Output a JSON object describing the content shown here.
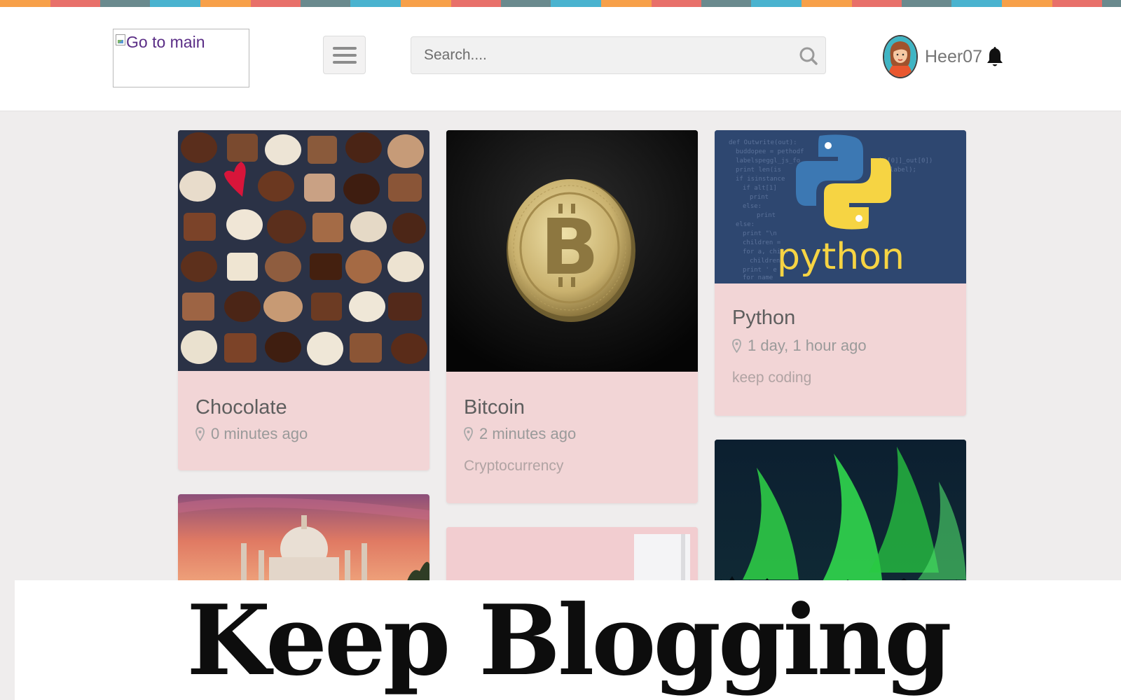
{
  "header": {
    "logo_alt": "Go to main",
    "search_placeholder": "Search....",
    "username": "Heer07"
  },
  "posts": [
    {
      "title": "Chocolate",
      "time": "0 minutes ago",
      "tag": ""
    },
    {
      "title": "Bitcoin",
      "time": "2 minutes ago",
      "tag": "Cryptocurrency"
    },
    {
      "title": "Python",
      "time": "1 day, 1 hour ago",
      "tag": "keep coding"
    }
  ],
  "python_logo_text": "python",
  "banner": {
    "text": "Keep Blogging"
  },
  "colors": {
    "card_bg": "#f2d5d6",
    "page_bg": "#efeded",
    "stripe": [
      "#f7a049",
      "#e8706a",
      "#6a8a8e",
      "#4ab3cf"
    ]
  },
  "icons": [
    "hamburger-menu-icon",
    "search-icon",
    "user-avatar",
    "bell-icon",
    "location-pin-icon"
  ]
}
